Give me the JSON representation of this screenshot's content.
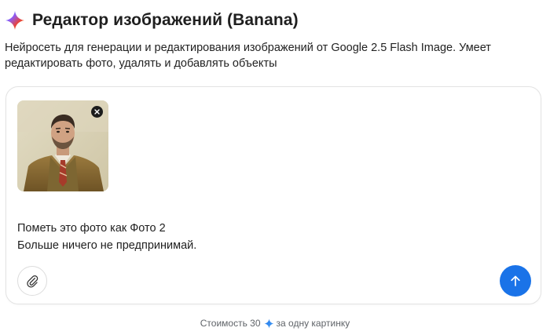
{
  "header": {
    "title": "Редактор изображений (Banana)",
    "logo_icon": "gemini-sparkle-icon"
  },
  "description": "Нейросеть для генерации и редактирования изображений от Google 2.5 Flash Image. Умеет редактировать фото, удалять и добавлять объекты",
  "composer": {
    "attachment": {
      "type": "image",
      "remove_icon": "close-icon"
    },
    "message_lines": [
      "Пометь это фото как Фото 2",
      "Больше ничего не предпринимай."
    ],
    "attach_icon": "paperclip-icon",
    "send_icon": "arrow-up-icon"
  },
  "cost": {
    "prefix": "Стоимость 30",
    "suffix": "за одну картинку",
    "icon": "sparkle-icon"
  },
  "colors": {
    "accent": "#1a73e8",
    "text": "#1f1f1f",
    "muted": "#5f6368",
    "border": "#e3e3e3"
  }
}
